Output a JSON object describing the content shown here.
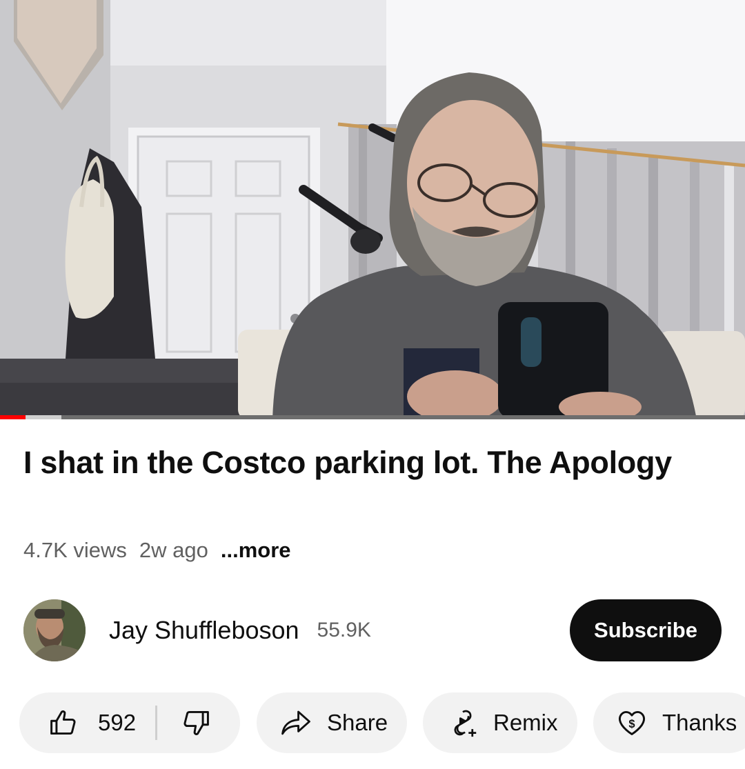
{
  "video": {
    "progress_played_fraction": 0.034,
    "progress_buffered_fraction": 0.082,
    "colors": {
      "played": "#ff0000",
      "buffered": "#cfcfcf",
      "track": "#6e6e6e"
    }
  },
  "title": "I shat in the Costco parking lot. The Apology",
  "meta": {
    "views": "4.7K views",
    "age": "2w ago",
    "more": "...more"
  },
  "channel": {
    "name": "Jay Shuffleboson",
    "subscribers": "55.9K",
    "subscribe_label": "Subscribe"
  },
  "actions": {
    "like_count": "592",
    "share_label": "Share",
    "remix_label": "Remix",
    "thanks_label": "Thanks"
  },
  "icons": [
    "thumbs-up-icon",
    "thumbs-down-icon",
    "share-arrow-icon",
    "remix-icon",
    "thanks-heart-icon"
  ]
}
